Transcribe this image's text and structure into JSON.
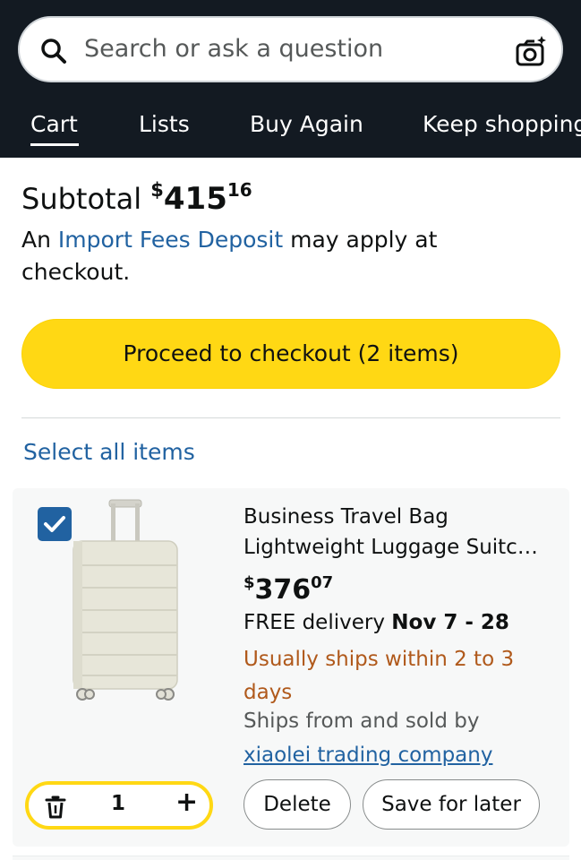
{
  "search": {
    "placeholder": "Search or ask a question",
    "icon": "search-icon",
    "camera_icon": "camera-icon"
  },
  "tabs": [
    {
      "label": "Cart",
      "active": true
    },
    {
      "label": "Lists"
    },
    {
      "label": "Buy Again"
    },
    {
      "label": "Keep shopping"
    }
  ],
  "summary": {
    "subtotal_label": "Subtotal",
    "currency": "$",
    "whole": "415",
    "fraction": "16",
    "fees_prefix": "An",
    "fees_link": "Import Fees Deposit",
    "fees_suffix": "may apply at checkout."
  },
  "checkout": {
    "label": "Proceed to checkout (2 items)"
  },
  "select_all": "Select all items",
  "item": {
    "checked": true,
    "title_line1": "Business Travel Bag",
    "title_line2": "Lightweight Luggage Suitc…",
    "currency": "$",
    "price_whole": "376",
    "price_fraction": "07",
    "delivery_label": "FREE delivery",
    "delivery_dates": "Nov 7 - 28",
    "ships_within": "Usually ships within 2 to 3 days",
    "ships_from": "Ships from and sold by",
    "seller": "xiaolei trading company",
    "quantity": "1",
    "delete_label": "Delete",
    "save_label": "Save for later"
  },
  "colors": {
    "header_bg": "#131a22",
    "checkout_yellow": "#ffd814",
    "link_blue": "#2162a1",
    "ships_orange": "#b0591b"
  }
}
